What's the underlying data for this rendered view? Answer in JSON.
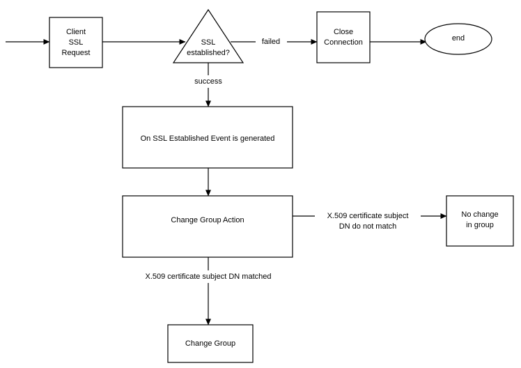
{
  "diagram": {
    "title": "SSL Connection Group Change Flowchart",
    "type": "flowchart",
    "background_color": "#ffffff",
    "stroke_color": "#000000",
    "nodes": [
      {
        "id": "client_ssl_request",
        "shape": "rectangle",
        "lines": [
          "Client",
          "SSL",
          "Request"
        ]
      },
      {
        "id": "ssl_established",
        "shape": "triangle",
        "lines": [
          "SSL",
          "established?"
        ]
      },
      {
        "id": "close_connection",
        "shape": "rectangle",
        "lines": [
          "Close",
          "Connection"
        ]
      },
      {
        "id": "end",
        "shape": "ellipse",
        "lines": [
          "end"
        ]
      },
      {
        "id": "on_ssl_established_event",
        "shape": "rectangle",
        "lines": [
          "On SSL Established Event is generated"
        ]
      },
      {
        "id": "change_group_action",
        "shape": "rectangle",
        "lines": [
          "Change Group Action"
        ]
      },
      {
        "id": "no_change_in_group",
        "shape": "rectangle",
        "lines": [
          "No change",
          "in group"
        ]
      },
      {
        "id": "change_group",
        "shape": "rectangle",
        "lines": [
          "Change Group"
        ]
      }
    ],
    "edge_labels": {
      "failed": "failed",
      "success": "success",
      "dn_no_match_line1": "X.509 certificate subject",
      "dn_no_match_line2": "DN do not match",
      "dn_matched": "X.509 certificate subject DN matched"
    }
  },
  "text": {
    "client_ssl_request_l1": "Client",
    "client_ssl_request_l2": "SSL",
    "client_ssl_request_l3": "Request",
    "ssl_established_l1": "SSL",
    "ssl_established_l2": "established?",
    "close_connection_l1": "Close",
    "close_connection_l2": "Connection",
    "end": "end",
    "on_ssl_established_event": "On SSL Established Event is generated",
    "change_group_action": "Change Group Action",
    "no_change_in_group_l1": "No change",
    "no_change_in_group_l2": "in group",
    "change_group": "Change Group",
    "failed": "failed",
    "success": "success",
    "dn_no_match_l1": "X.509 certificate subject",
    "dn_no_match_l2": "DN do not match",
    "dn_matched": "X.509 certificate subject DN matched"
  }
}
